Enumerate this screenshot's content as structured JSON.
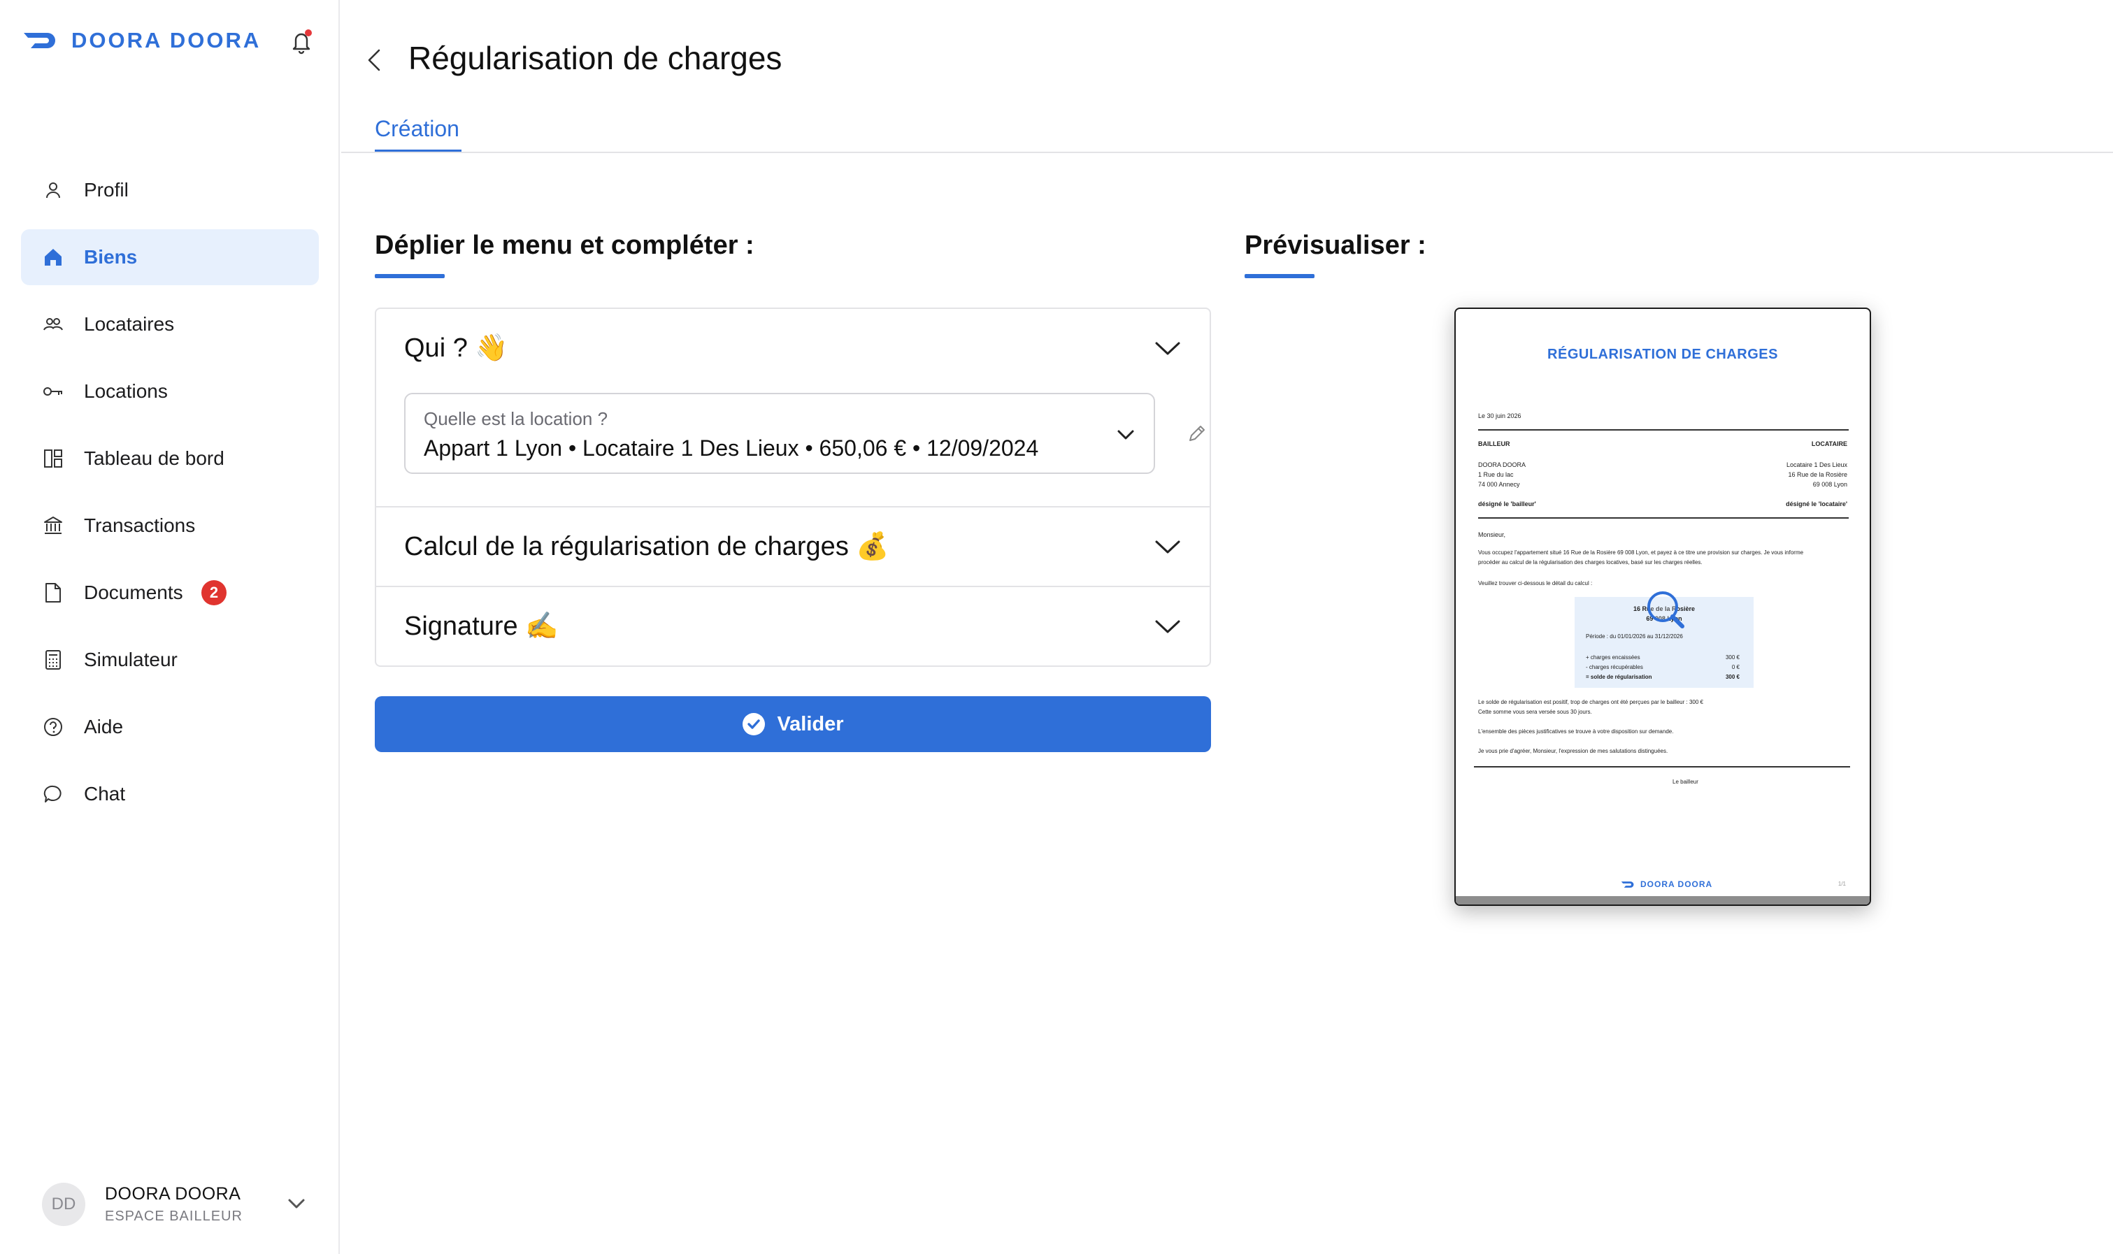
{
  "app": {
    "brand": "DOORA DOORA",
    "accent_color": "#2f6fd8",
    "has_notification_dot": true
  },
  "sidebar": {
    "items": [
      {
        "label": "Profil",
        "icon": "user-icon",
        "active": false
      },
      {
        "label": "Biens",
        "icon": "home-icon",
        "active": true
      },
      {
        "label": "Locataires",
        "icon": "users-icon",
        "active": false
      },
      {
        "label": "Locations",
        "icon": "key-icon",
        "active": false
      },
      {
        "label": "Tableau de bord",
        "icon": "dashboard-icon",
        "active": false
      },
      {
        "label": "Transactions",
        "icon": "bank-icon",
        "active": false
      },
      {
        "label": "Documents",
        "icon": "document-icon",
        "active": false,
        "badge": "2"
      },
      {
        "label": "Simulateur",
        "icon": "calculator-icon",
        "active": false
      },
      {
        "label": "Aide",
        "icon": "help-icon",
        "active": false
      },
      {
        "label": "Chat",
        "icon": "chat-icon",
        "active": false
      }
    ],
    "user": {
      "initials": "DD",
      "name": "DOORA DOORA",
      "role": "ESPACE BAILLEUR"
    }
  },
  "page": {
    "title": "Régularisation de charges",
    "tab": "Création",
    "left_section_title": "Déplier le menu et compléter :",
    "right_section_title": "Prévisualiser :"
  },
  "accordion": {
    "sections": [
      {
        "title": "Qui ? 👋"
      },
      {
        "title": "Calcul de la régularisation de charges 💰"
      },
      {
        "title": "Signature ✍️"
      }
    ],
    "location_select": {
      "label": "Quelle est la location ?",
      "value": "Appart 1 Lyon • Locataire 1 Des Lieux • 650,06 € • 12/09/2024"
    }
  },
  "validate_label": "Valider",
  "preview_doc": {
    "title": "RÉGULARISATION DE CHARGES",
    "date": "Le 30 juin 2026",
    "bailleur_header": "BAILLEUR",
    "locataire_header": "LOCATAIRE",
    "bailleur_lines": [
      "DOORA DOORA",
      "1 Rue du lac",
      "74 000 Annecy"
    ],
    "locataire_lines": [
      "Locataire 1 Des Lieux",
      "16 Rue de la Rosière",
      "69 008 Lyon"
    ],
    "bailleur_designation": "désigné le 'bailleur'",
    "locataire_designation": "désigné le 'locataire'",
    "salutation": "Monsieur,",
    "paragraph1_line1": "Vous occupez l'appartement situé 16 Rue de la Rosière 69 008 Lyon, et payez à ce titre une provision sur charges. Je vous informe",
    "paragraph1_line2": "procéder au calcul de la régularisation des charges locatives, basé sur les charges réelles.",
    "detail_intro": "Veuillez trouver ci-dessous le détail du calcul :",
    "box_address_line1": "16 Rue de la Rosière",
    "box_address_line2": "69 008 Lyon",
    "box_period": "Période : du 01/01/2026 au 31/12/2026",
    "box_rows": [
      {
        "label": "+ charges encaissées",
        "value": "300 €",
        "bold": false
      },
      {
        "label": "- charges récupérables",
        "value": "0 €",
        "bold": false
      },
      {
        "label": "= solde de régularisation",
        "value": "300 €",
        "bold": true
      }
    ],
    "result_line1": "Le solde de régularisation est positif, trop de charges ont été perçues par le bailleur : 300 €",
    "result_line2": "Cette somme vous sera versée sous 30 jours.",
    "justification": "L'ensemble des pièces justificatives se trouve à votre disposition sur demande.",
    "closing": "Je vous prie d'agréer, Monsieur, l'expression de mes salutations distinguées.",
    "signature": "Le bailleur",
    "footer_brand": "DOORA DOORA",
    "page_number": "1/1"
  }
}
